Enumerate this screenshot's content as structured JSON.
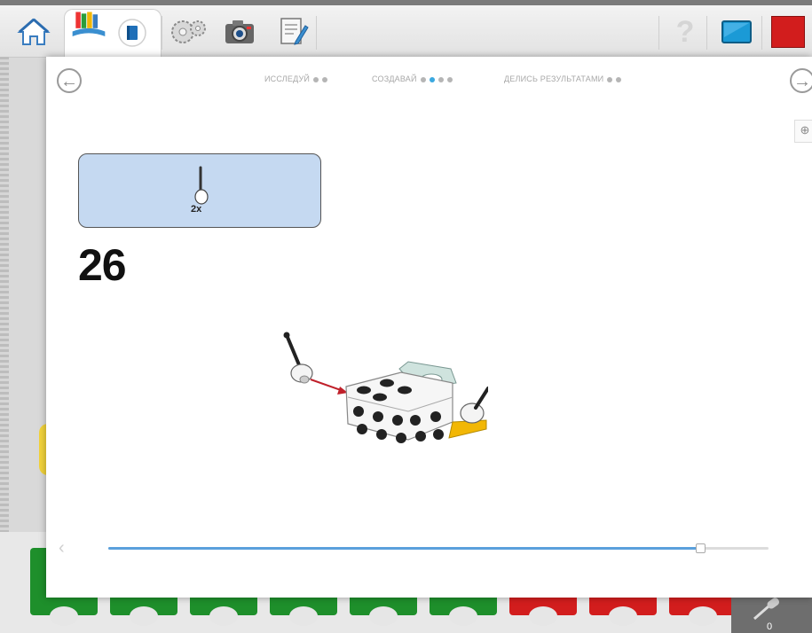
{
  "toolbar": {
    "items": [
      {
        "name": "home-icon"
      },
      {
        "name": "library-books-icon",
        "active": true
      },
      {
        "name": "book-icon"
      },
      {
        "name": "gears-icon"
      },
      {
        "name": "camera-icon"
      },
      {
        "name": "documentation-icon"
      },
      {
        "name": "help-icon"
      },
      {
        "name": "display-icon"
      },
      {
        "name": "stop-icon"
      }
    ]
  },
  "modal": {
    "steps": [
      {
        "label": "ИССЛЕДУЙ",
        "dots": 2,
        "active_dot": -1
      },
      {
        "label": "СОЗДАВАЙ",
        "dots": 4,
        "active_dot": 1
      },
      {
        "label": "ДЕЛИСЬ РЕЗУЛЬТАТАМИ",
        "dots": 2,
        "active_dot": -1
      }
    ],
    "parts": {
      "quantity": "2x",
      "part_icon": "connector-peg-icon"
    },
    "step_number": "26",
    "progress_fraction": 0.895
  },
  "bottom": {
    "counter": "0"
  },
  "colors": {
    "accent": "#3aa8e0",
    "parts_bg": "#c5d9f1",
    "block_green": "#1e8f2b",
    "block_red": "#d21d1d",
    "stop_red": "#d21d1d"
  }
}
